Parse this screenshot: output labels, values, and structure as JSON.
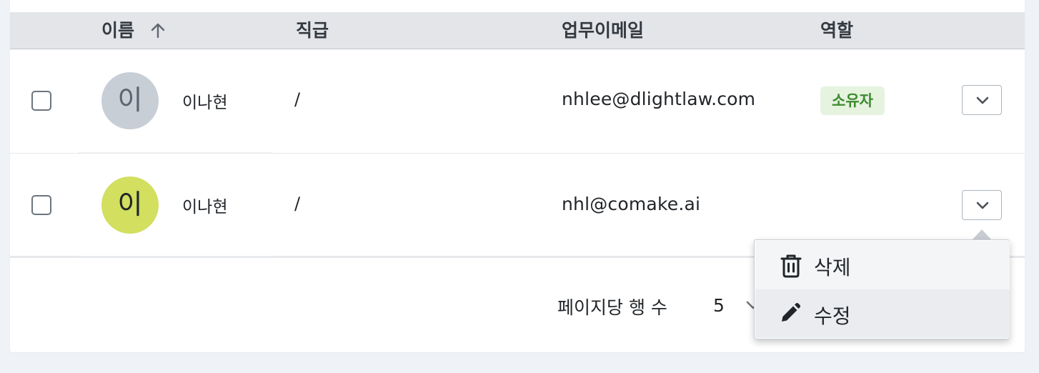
{
  "table": {
    "columns": {
      "name": "이름",
      "title": "직급",
      "email": "업무이메일",
      "role": "역할"
    },
    "rows": [
      {
        "avatar_initial": "이",
        "name": "이나현",
        "title": "/",
        "email": "nhlee@dlightlaw.com",
        "role": "소유자"
      },
      {
        "avatar_initial": "이",
        "name": "이나현",
        "title": "/",
        "email": "nhl@comake.ai",
        "role": ""
      }
    ]
  },
  "pagination": {
    "rows_per_page_label": "페이지당 행 수",
    "rows_per_page_value": "5"
  },
  "row_menu": {
    "items": [
      {
        "label": "삭제",
        "icon": "trash-icon"
      },
      {
        "label": "수정",
        "icon": "pencil-icon"
      }
    ]
  },
  "colors": {
    "accent_badge_bg": "#e5f3df",
    "accent_badge_text": "#3d8b2f",
    "avatar_gray": "#c8ced6",
    "avatar_lime": "#d2df5f"
  },
  "icons": {
    "sort": "arrow-up-icon",
    "row_toggle": "chevron-down-icon"
  }
}
